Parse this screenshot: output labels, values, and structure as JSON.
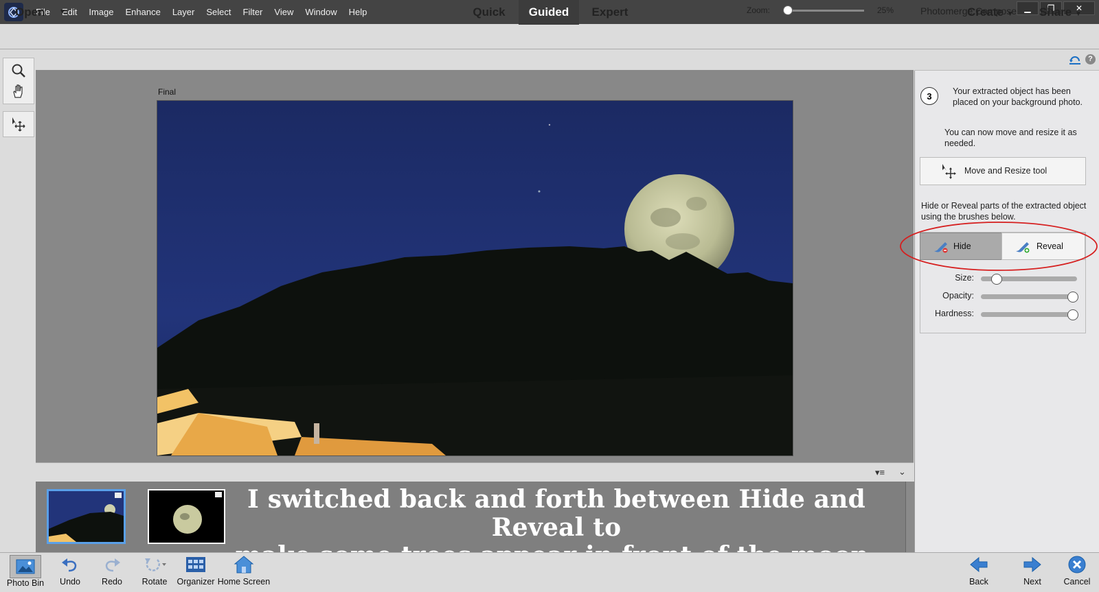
{
  "menu": {
    "items": [
      "File",
      "Edit",
      "Image",
      "Enhance",
      "Layer",
      "Select",
      "Filter",
      "View",
      "Window",
      "Help"
    ]
  },
  "window_controls": {
    "minimize": "▁",
    "restore": "❐",
    "close": "✕"
  },
  "modebar": {
    "open_label": "Open",
    "tabs": [
      "Quick",
      "Guided",
      "Expert"
    ],
    "active_tab": "Guided",
    "create_label": "Create",
    "share_label": "Share"
  },
  "zoom": {
    "label": "Zoom:",
    "value": "25%",
    "level_fraction": 0.0
  },
  "canvas": {
    "image_label": "Final"
  },
  "caption": {
    "line1": "I switched back and forth between Hide and Reveal to",
    "line2": "make some trees appear in front of the moon."
  },
  "panel": {
    "title": "Photomerge Compose",
    "step_number": "3",
    "step_text": "Your extracted object has been placed on your background photo.",
    "step_text2": "You can now move and resize it as needed.",
    "move_resize_label": "Move and Resize tool",
    "hide_reveal_text": "Hide or Reveal parts of the extracted object using the brushes below.",
    "hide_label": "Hide",
    "reveal_label": "Reveal",
    "sliders": [
      {
        "label": "Size:",
        "level_fraction": 0.12
      },
      {
        "label": "Opacity:",
        "level_fraction": 1.0
      },
      {
        "label": "Hardness:",
        "level_fraction": 1.0
      }
    ]
  },
  "bottom": {
    "photo_bin": "Photo Bin",
    "undo": "Undo",
    "redo": "Redo",
    "rotate": "Rotate",
    "organizer": "Organizer",
    "home_screen": "Home Screen",
    "back": "Back",
    "next": "Next",
    "cancel": "Cancel"
  },
  "colors": {
    "accent_blue": "#1a6fc4",
    "annotation_red": "#d61f1f",
    "active_tab_bg": "#3c3c3c"
  }
}
